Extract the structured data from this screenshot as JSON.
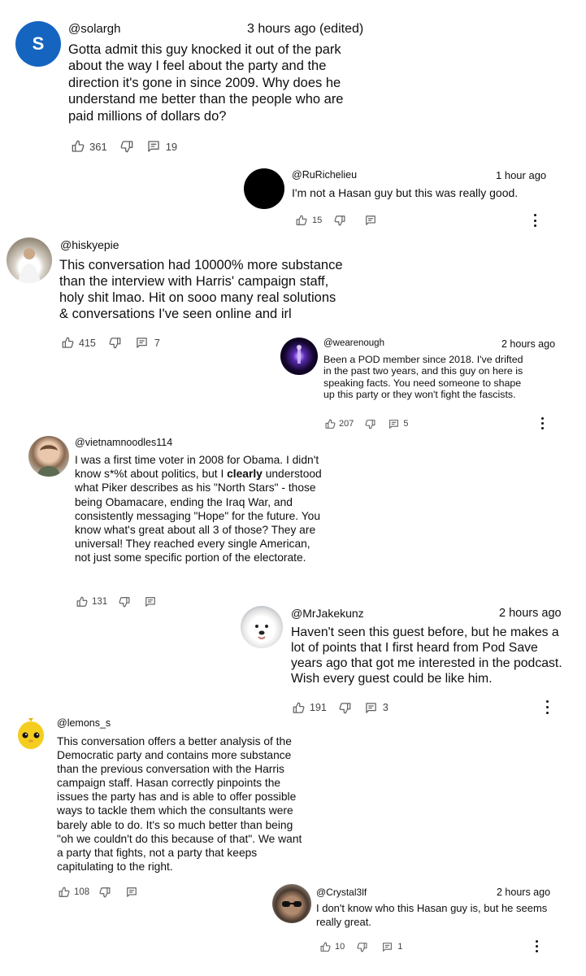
{
  "comments": [
    {
      "handle": "@solargh",
      "time": "3 hours ago (edited)",
      "avatar_letter": "S",
      "avatar_color": "#1565c0",
      "text": "Gotta admit this guy knocked it out of the park about the way I feel about the party and the direction it's gone in since 2009. Why does he understand me better than the people who are paid millions of dollars do?",
      "likes": "361",
      "replies": "19"
    },
    {
      "handle": "@RuRichelieu",
      "time": "1 hour ago",
      "avatar_color": "#000000",
      "text": "I'm not a Hasan guy but this was really good.",
      "likes": "15",
      "replies": ""
    },
    {
      "handle": "@hiskyepie",
      "time": "",
      "text": "This conversation had 10000% more substance than the interview with Harris' campaign staff, holy shit lmao. Hit on sooo many real solutions & conversations I've seen online and  irl",
      "likes": "415",
      "replies": "7"
    },
    {
      "handle": "@wearenough",
      "time": "2 hours ago",
      "text": "Been a POD member since 2018. I've drifted in the past two years, and this guy on here is speaking facts. You need someone to shape up this party or they won't fight the fascists.",
      "likes": "207",
      "replies": "5"
    },
    {
      "handle": "@vietnamnoodles114",
      "time": "",
      "text_before": "I was a first time voter in 2008 for Obama.  I didn't know s*%t about politics, but I ",
      "text_bold": "clearly",
      "text_after": " understood what Piker describes as his \"North Stars\" - those being Obamacare, ending the Iraq War, and consistently messaging \"Hope\" for the future.  You know what's great about all 3 of those? They are universal! They reached every single American, not just some specific portion of the electorate.",
      "likes": "131",
      "replies": ""
    },
    {
      "handle": "@MrJakekunz",
      "time": "2 hours ago",
      "text": "Haven't seen this guest before, but he makes a lot of points that I first heard from Pod Save years ago that got me interested in the podcast. Wish every guest could be like him.",
      "likes": "191",
      "replies": "3"
    },
    {
      "handle": "@lemons_s",
      "time": "",
      "text": "This conversation offers a better analysis of the Democratic party and contains more substance than the previous conversation with the Harris campaign staff. Hasan correctly pinpoints the issues the party has and is able to offer possible ways to tackle them which the consultants were barely able to do. It's so much better than being \"oh we couldn't do this because of that\". We want a party that fights, not a party that keeps capitulating to the right.",
      "likes": "108",
      "replies": ""
    },
    {
      "handle": "@Crystal3lf",
      "time": "2 hours ago",
      "text": "I don't know who this Hasan guy is, but he seems really great.",
      "likes": "10",
      "replies": "1"
    }
  ]
}
